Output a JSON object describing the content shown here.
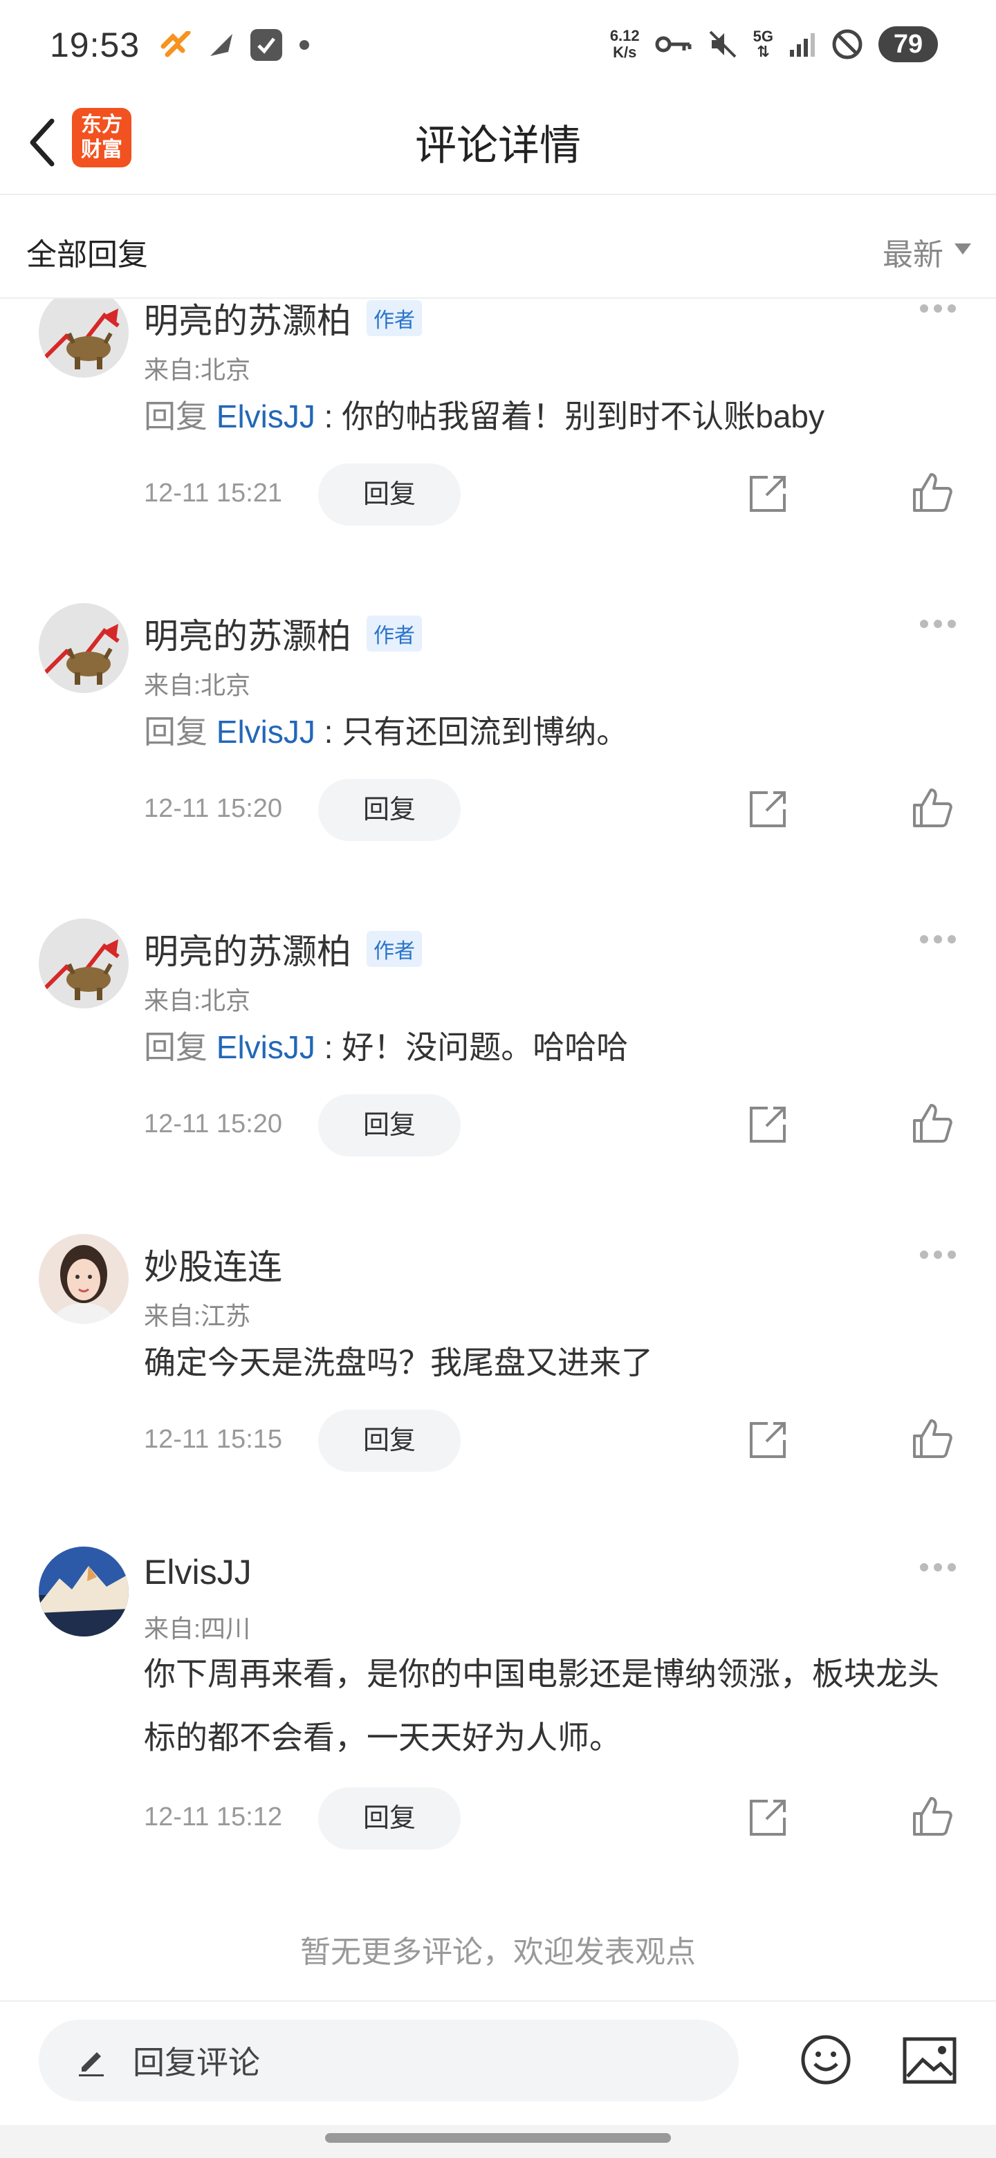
{
  "status_bar": {
    "time": "19:53",
    "net_speed_value": "6.12",
    "net_speed_unit": "K/s",
    "network": "5G",
    "battery": "79",
    "icons": [
      "app-notification-icon",
      "send-icon",
      "check-box-icon",
      "dot-icon",
      "key-icon",
      "mute-icon",
      "signal-icon",
      "do-not-disturb-icon"
    ]
  },
  "header": {
    "title": "评论详情",
    "logo_line1": "东方",
    "logo_line2": "财富",
    "logo_color": "#f2521f"
  },
  "filter": {
    "label": "全部回复",
    "sort": "最新"
  },
  "comments": [
    {
      "username": "明亮的苏灏柏",
      "badge": "作者",
      "location": "来自:北京",
      "reply_prefix": "回复",
      "reply_to": "ElvisJJ",
      "text": " : 你的帖我留着！别到时不认账baby",
      "time": "12-11 15:21",
      "reply_label": "回复"
    },
    {
      "username": "明亮的苏灏柏",
      "badge": "作者",
      "location": "来自:北京",
      "reply_prefix": "回复",
      "reply_to": "ElvisJJ",
      "text": " : 只有还回流到博纳。",
      "time": "12-11 15:20",
      "reply_label": "回复"
    },
    {
      "username": "明亮的苏灏柏",
      "badge": "作者",
      "location": "来自:北京",
      "reply_prefix": "回复",
      "reply_to": "ElvisJJ",
      "text": " : 好！没问题。哈哈哈",
      "time": "12-11 15:20",
      "reply_label": "回复"
    },
    {
      "username": "妙股连连",
      "location": "来自:江苏",
      "text": "确定今天是洗盘吗？我尾盘又进来了",
      "time": "12-11 15:15",
      "reply_label": "回复"
    },
    {
      "username": "ElvisJJ",
      "location": "来自:四川",
      "text": "你下周再来看，是你的中国电影还是博纳领涨，板块龙头标的都不会看，一天天好为人师。",
      "time": "12-11 15:12",
      "reply_label": "回复"
    }
  ],
  "end_note": "暂无更多评论，欢迎发表观点",
  "bottom_bar": {
    "input_placeholder": "回复评论"
  },
  "colors": {
    "link": "#2267b8",
    "badge_bg": "#e6f1fd",
    "badge_text": "#2a73c9"
  }
}
